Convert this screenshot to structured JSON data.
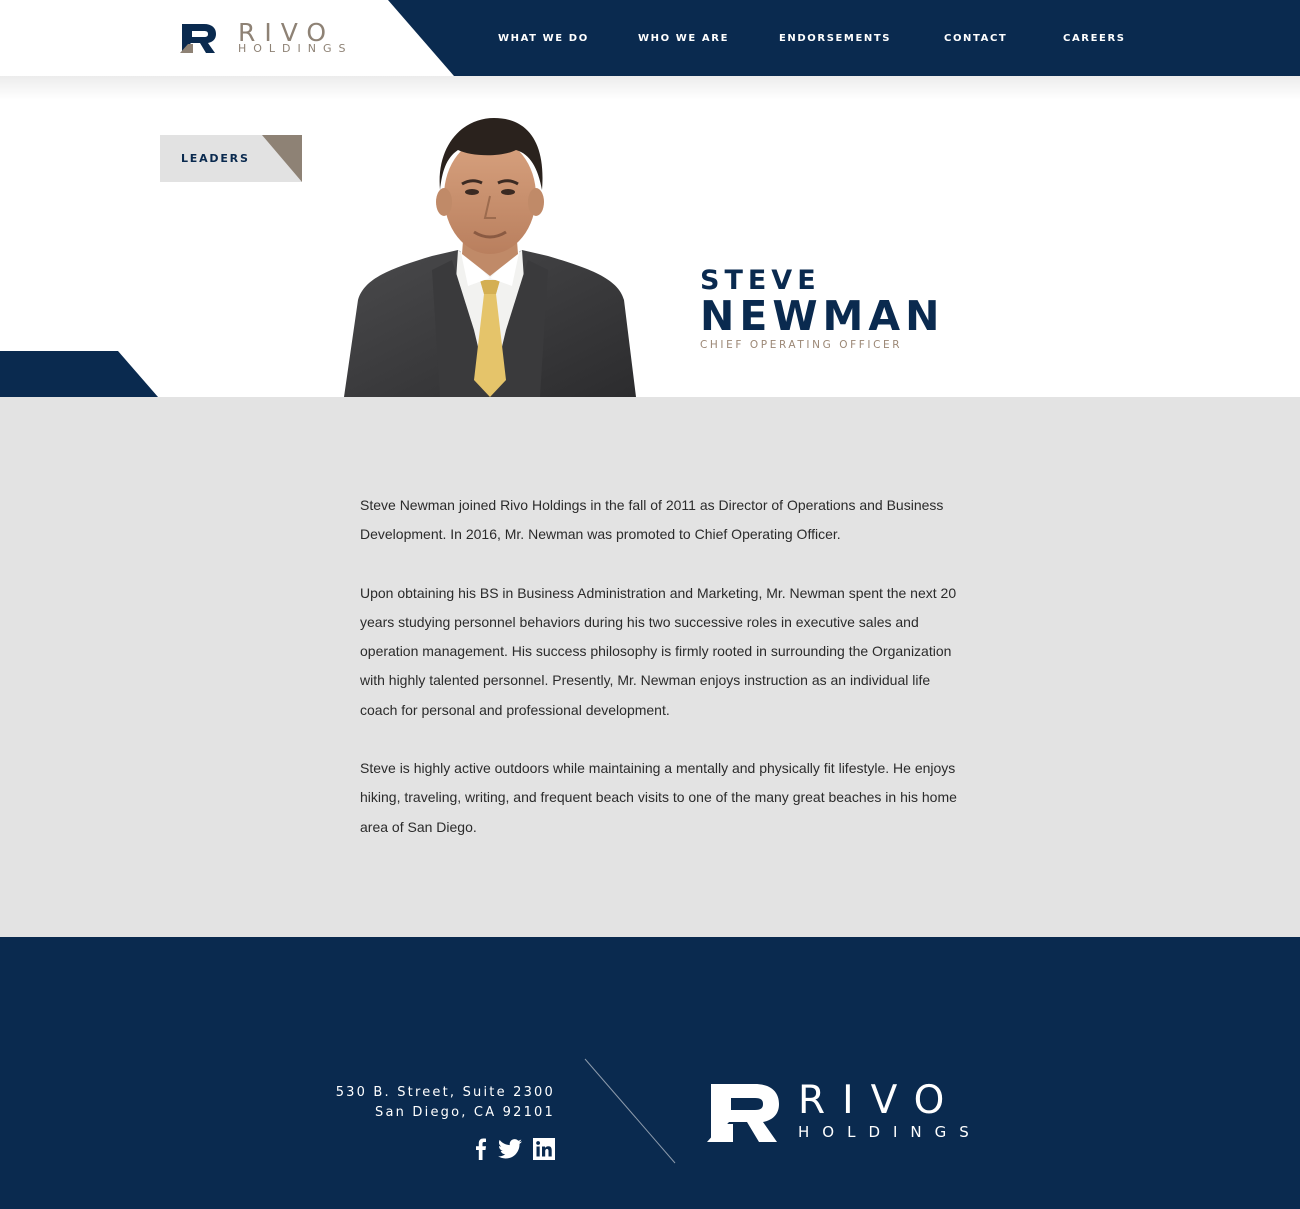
{
  "brand": {
    "name": "RIVO",
    "sub": "HOLDINGS",
    "colors": {
      "navy": "#0a2a4f",
      "taupe": "#8e8275",
      "gray": "#e3e3e3"
    }
  },
  "nav": {
    "items": [
      {
        "label": "WHAT WE DO"
      },
      {
        "label": "WHO WE ARE"
      },
      {
        "label": "ENDORSEMENTS"
      },
      {
        "label": "CONTACT"
      },
      {
        "label": "CAREERS"
      }
    ]
  },
  "hero": {
    "tag": "LEADERS",
    "first_name": "STEVE",
    "last_name": "NEWMAN",
    "title": "CHIEF OPERATING OFFICER"
  },
  "bio": {
    "paragraphs": [
      "Steve Newman joined Rivo Holdings in the fall of 2011 as Director of Operations and Business Development.  In 2016, Mr. Newman was promoted to Chief Operating Officer.",
      "Upon obtaining his BS in Business Administration and Marketing, Mr. Newman spent the next 20 years studying personnel behaviors during his two successive roles in executive sales and operation management. His success philosophy is firmly rooted in surrounding the Organization with highly talented personnel.  Presently, Mr. Newman enjoys instruction as an individual life coach for personal and professional development.",
      "Steve is highly active outdoors while maintaining a mentally and physically fit lifestyle.  He enjoys hiking, traveling, writing, and frequent beach visits to one of the many great beaches in his home area of San Diego."
    ]
  },
  "footer": {
    "address_line1": "530 B. Street, Suite 2300",
    "address_line2": "San Diego, CA 92101",
    "social": [
      "facebook-icon",
      "twitter-icon",
      "linkedin-icon"
    ]
  }
}
